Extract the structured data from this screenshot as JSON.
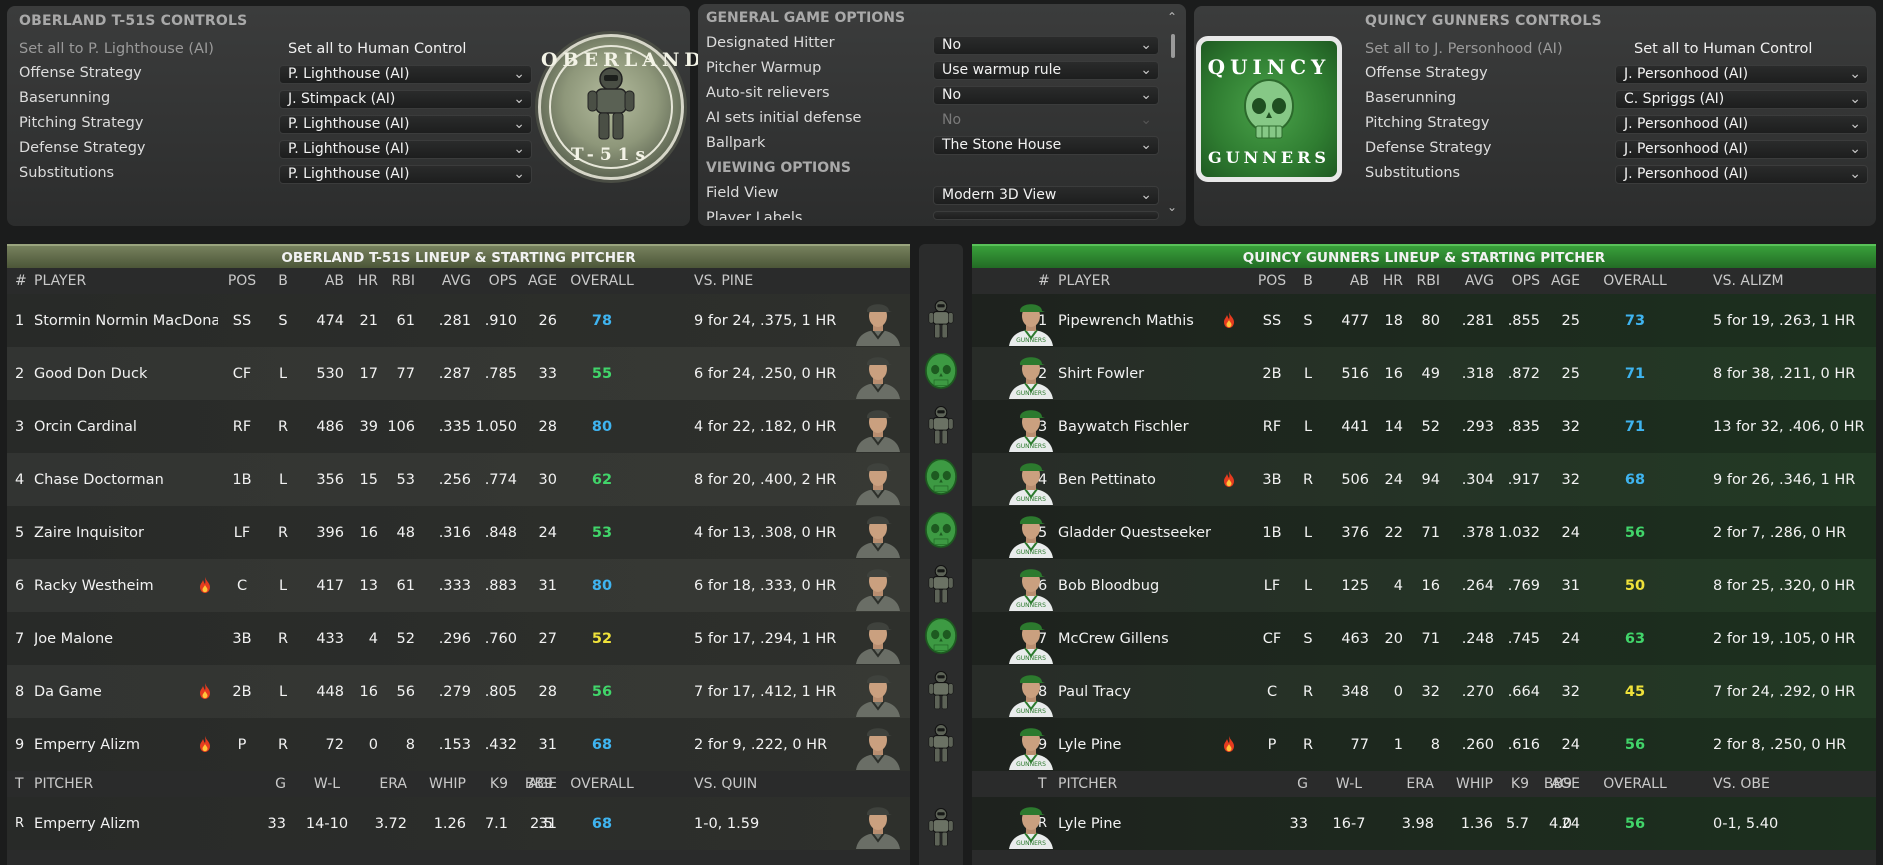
{
  "home": {
    "title": "OBERLAND T-51S CONTROLS",
    "set_all_ai": "Set all to P. Lighthouse (AI)",
    "set_all_human": "Set all to Human Control",
    "controls": [
      {
        "label": "Offense Strategy",
        "value": "P. Lighthouse (AI)"
      },
      {
        "label": "Baserunning",
        "value": "J. Stimpack (AI)"
      },
      {
        "label": "Pitching Strategy",
        "value": "P. Lighthouse (AI)"
      },
      {
        "label": "Defense Strategy",
        "value": "P. Lighthouse (AI)"
      },
      {
        "label": "Substitutions",
        "value": "P. Lighthouse (AI)"
      }
    ],
    "logo_top": "OBERLAND",
    "logo_bottom": "T-51s"
  },
  "options": {
    "general_title": "GENERAL GAME OPTIONS",
    "viewing_title": "VIEWING OPTIONS",
    "items": [
      {
        "label": "Designated Hitter",
        "value": "No"
      },
      {
        "label": "Pitcher Warmup",
        "value": "Use warmup rule"
      },
      {
        "label": "Auto-sit relievers",
        "value": "No"
      },
      {
        "label": "AI sets initial defense",
        "value": "No"
      },
      {
        "label": "Ballpark",
        "value": "The Stone House"
      }
    ],
    "view_items": [
      {
        "label": "Field View",
        "value": "Modern 3D View"
      },
      {
        "label": "Player Labels",
        "value": ""
      }
    ]
  },
  "away": {
    "title": "QUINCY GUNNERS CONTROLS",
    "set_all_ai": "Set all to J. Personhood (AI)",
    "set_all_human": "Set all to Human Control",
    "controls": [
      {
        "label": "Offense Strategy",
        "value": "J. Personhood (AI)"
      },
      {
        "label": "Baserunning",
        "value": "C. Spriggs (AI)"
      },
      {
        "label": "Pitching Strategy",
        "value": "J. Personhood (AI)"
      },
      {
        "label": "Defense Strategy",
        "value": "J. Personhood (AI)"
      },
      {
        "label": "Substitutions",
        "value": "J. Personhood (AI)"
      }
    ],
    "logo_top": "QUINCY",
    "logo_bottom": "GUNNERS"
  },
  "colors": {
    "ov_blue": "#3fb4f0",
    "ov_green": "#41d56a",
    "ov_yellow": "#f0e23a",
    "obe_header": "#6b7552",
    "qg_header": "#2f8a31"
  },
  "obe_lineup": {
    "header": "OBERLAND T-51S LINEUP & STARTING PITCHER",
    "cols": {
      "num": "#",
      "player": "PLAYER",
      "pos": "POS",
      "b": "B",
      "ab": "AB",
      "hr": "HR",
      "rbi": "RBI",
      "avg": "AVG",
      "ops": "OPS",
      "age": "AGE",
      "overall": "OVERALL",
      "vs": "VS. PINE"
    },
    "rows": [
      {
        "n": "1",
        "name": "Stormin Normin MacDonald",
        "hot": false,
        "pos": "SS",
        "b": "S",
        "ab": "474",
        "hr": "21",
        "rbi": "61",
        "avg": ".281",
        "ops": ".910",
        "age": "26",
        "ov": "78",
        "ovc": "blue",
        "vs": "9 for 24, .375, 1 HR"
      },
      {
        "n": "2",
        "name": "Good Don Duck",
        "hot": false,
        "pos": "CF",
        "b": "L",
        "ab": "530",
        "hr": "17",
        "rbi": "77",
        "avg": ".287",
        "ops": ".785",
        "age": "33",
        "ov": "55",
        "ovc": "green",
        "vs": "6 for 24, .250, 0 HR"
      },
      {
        "n": "3",
        "name": "Orcin Cardinal",
        "hot": false,
        "pos": "RF",
        "b": "R",
        "ab": "486",
        "hr": "39",
        "rbi": "106",
        "avg": ".335",
        "ops": "1.050",
        "age": "28",
        "ov": "80",
        "ovc": "blue",
        "vs": "4 for 22, .182, 0 HR"
      },
      {
        "n": "4",
        "name": "Chase Doctorman",
        "hot": false,
        "pos": "1B",
        "b": "L",
        "ab": "356",
        "hr": "15",
        "rbi": "53",
        "avg": ".256",
        "ops": ".774",
        "age": "30",
        "ov": "62",
        "ovc": "green",
        "vs": "8 for 20, .400, 2 HR"
      },
      {
        "n": "5",
        "name": "Zaire Inquisitor",
        "hot": false,
        "pos": "LF",
        "b": "R",
        "ab": "396",
        "hr": "16",
        "rbi": "48",
        "avg": ".316",
        "ops": ".848",
        "age": "24",
        "ov": "53",
        "ovc": "green",
        "vs": "4 for 13, .308, 0 HR"
      },
      {
        "n": "6",
        "name": "Racky Westheim",
        "hot": true,
        "pos": "C",
        "b": "L",
        "ab": "417",
        "hr": "13",
        "rbi": "61",
        "avg": ".333",
        "ops": ".883",
        "age": "31",
        "ov": "80",
        "ovc": "blue",
        "vs": "6 for 18, .333, 0 HR"
      },
      {
        "n": "7",
        "name": "Joe Malone",
        "hot": false,
        "pos": "3B",
        "b": "R",
        "ab": "433",
        "hr": "4",
        "rbi": "52",
        "avg": ".296",
        "ops": ".760",
        "age": "27",
        "ov": "52",
        "ovc": "yellow",
        "vs": "5 for 17, .294, 1 HR"
      },
      {
        "n": "8",
        "name": "Da Game",
        "hot": true,
        "pos": "2B",
        "b": "L",
        "ab": "448",
        "hr": "16",
        "rbi": "56",
        "avg": ".279",
        "ops": ".805",
        "age": "28",
        "ov": "56",
        "ovc": "green",
        "vs": "7 for 17, .412, 1 HR"
      },
      {
        "n": "9",
        "name": "Emperry Alizm",
        "hot": true,
        "pos": "P",
        "b": "R",
        "ab": "72",
        "hr": "0",
        "rbi": "8",
        "avg": ".153",
        "ops": ".432",
        "age": "31",
        "ov": "68",
        "ovc": "blue",
        "vs": "2 for 9, .222, 0 HR"
      }
    ],
    "pcols": {
      "t": "T",
      "pitcher": "PITCHER",
      "g": "G",
      "wl": "W-L",
      "era": "ERA",
      "whip": "WHIP",
      "k9": "K9",
      "bb9": "BB9",
      "age": "AGE",
      "overall": "OVERALL",
      "vs": "VS. QUIN"
    },
    "pitcher": {
      "t": "R",
      "name": "Emperry Alizm",
      "g": "33",
      "wl": "14-10",
      "era": "3.72",
      "whip": "1.26",
      "k9": "7.1",
      "bb9": "2.5",
      "age": "31",
      "ov": "68",
      "vs": "1-0, 1.59"
    }
  },
  "qg_lineup": {
    "header": "QUINCY GUNNERS LINEUP & STARTING PITCHER",
    "cols": {
      "num": "#",
      "player": "PLAYER",
      "pos": "POS",
      "b": "B",
      "ab": "AB",
      "hr": "HR",
      "rbi": "RBI",
      "avg": "AVG",
      "ops": "OPS",
      "age": "AGE",
      "overall": "OVERALL",
      "vs": "VS. ALIZM"
    },
    "rows": [
      {
        "n": "1",
        "name": "Pipewrench Mathis",
        "hot": true,
        "pos": "SS",
        "b": "S",
        "ab": "477",
        "hr": "18",
        "rbi": "80",
        "avg": ".281",
        "ops": ".855",
        "age": "25",
        "ov": "73",
        "ovc": "blue",
        "vs": "5 for 19, .263, 1 HR"
      },
      {
        "n": "2",
        "name": "Shirt Fowler",
        "hot": false,
        "pos": "2B",
        "b": "L",
        "ab": "516",
        "hr": "16",
        "rbi": "49",
        "avg": ".318",
        "ops": ".872",
        "age": "25",
        "ov": "71",
        "ovc": "blue",
        "vs": "8 for 38, .211, 0 HR"
      },
      {
        "n": "3",
        "name": "Baywatch Fischler",
        "hot": false,
        "pos": "RF",
        "b": "L",
        "ab": "441",
        "hr": "14",
        "rbi": "52",
        "avg": ".293",
        "ops": ".835",
        "age": "32",
        "ov": "71",
        "ovc": "blue",
        "vs": "13 for 32, .406, 0 HR"
      },
      {
        "n": "4",
        "name": "Ben Pettinato",
        "hot": true,
        "pos": "3B",
        "b": "R",
        "ab": "506",
        "hr": "24",
        "rbi": "94",
        "avg": ".304",
        "ops": ".917",
        "age": "32",
        "ov": "68",
        "ovc": "blue",
        "vs": "9 for 26, .346, 1 HR"
      },
      {
        "n": "5",
        "name": "Gladder Questseeker",
        "hot": false,
        "pos": "1B",
        "b": "L",
        "ab": "376",
        "hr": "22",
        "rbi": "71",
        "avg": ".378",
        "ops": "1.032",
        "age": "24",
        "ov": "56",
        "ovc": "green",
        "vs": "2 for 7, .286, 0 HR"
      },
      {
        "n": "6",
        "name": "Bob Bloodbug",
        "hot": false,
        "pos": "LF",
        "b": "L",
        "ab": "125",
        "hr": "4",
        "rbi": "16",
        "avg": ".264",
        "ops": ".769",
        "age": "31",
        "ov": "50",
        "ovc": "yellow",
        "vs": "8 for 25, .320, 0 HR"
      },
      {
        "n": "7",
        "name": "McCrew Gillens",
        "hot": false,
        "pos": "CF",
        "b": "S",
        "ab": "463",
        "hr": "20",
        "rbi": "71",
        "avg": ".248",
        "ops": ".745",
        "age": "24",
        "ov": "63",
        "ovc": "green",
        "vs": "2 for 19, .105, 0 HR"
      },
      {
        "n": "8",
        "name": "Paul Tracy",
        "hot": false,
        "pos": "C",
        "b": "R",
        "ab": "348",
        "hr": "0",
        "rbi": "32",
        "avg": ".270",
        "ops": ".664",
        "age": "32",
        "ov": "45",
        "ovc": "yellow",
        "vs": "7 for 24, .292, 0 HR"
      },
      {
        "n": "9",
        "name": "Lyle Pine",
        "hot": true,
        "pos": "P",
        "b": "R",
        "ab": "77",
        "hr": "1",
        "rbi": "8",
        "avg": ".260",
        "ops": ".616",
        "age": "24",
        "ov": "56",
        "ovc": "green",
        "vs": "2 for 8, .250, 0 HR"
      }
    ],
    "pcols": {
      "t": "T",
      "pitcher": "PITCHER",
      "g": "G",
      "wl": "W-L",
      "era": "ERA",
      "whip": "WHIP",
      "k9": "K9",
      "bb9": "BB9",
      "age": "AGE",
      "overall": "OVERALL",
      "vs": "VS. OBE"
    },
    "pitcher": {
      "t": "R",
      "name": "Lyle Pine",
      "g": "33",
      "wl": "16-7",
      "era": "3.98",
      "whip": "1.36",
      "k9": "5.7",
      "bb9": "4.0",
      "age": "24",
      "ov": "56",
      "vs": "0-1, 5.40"
    }
  }
}
